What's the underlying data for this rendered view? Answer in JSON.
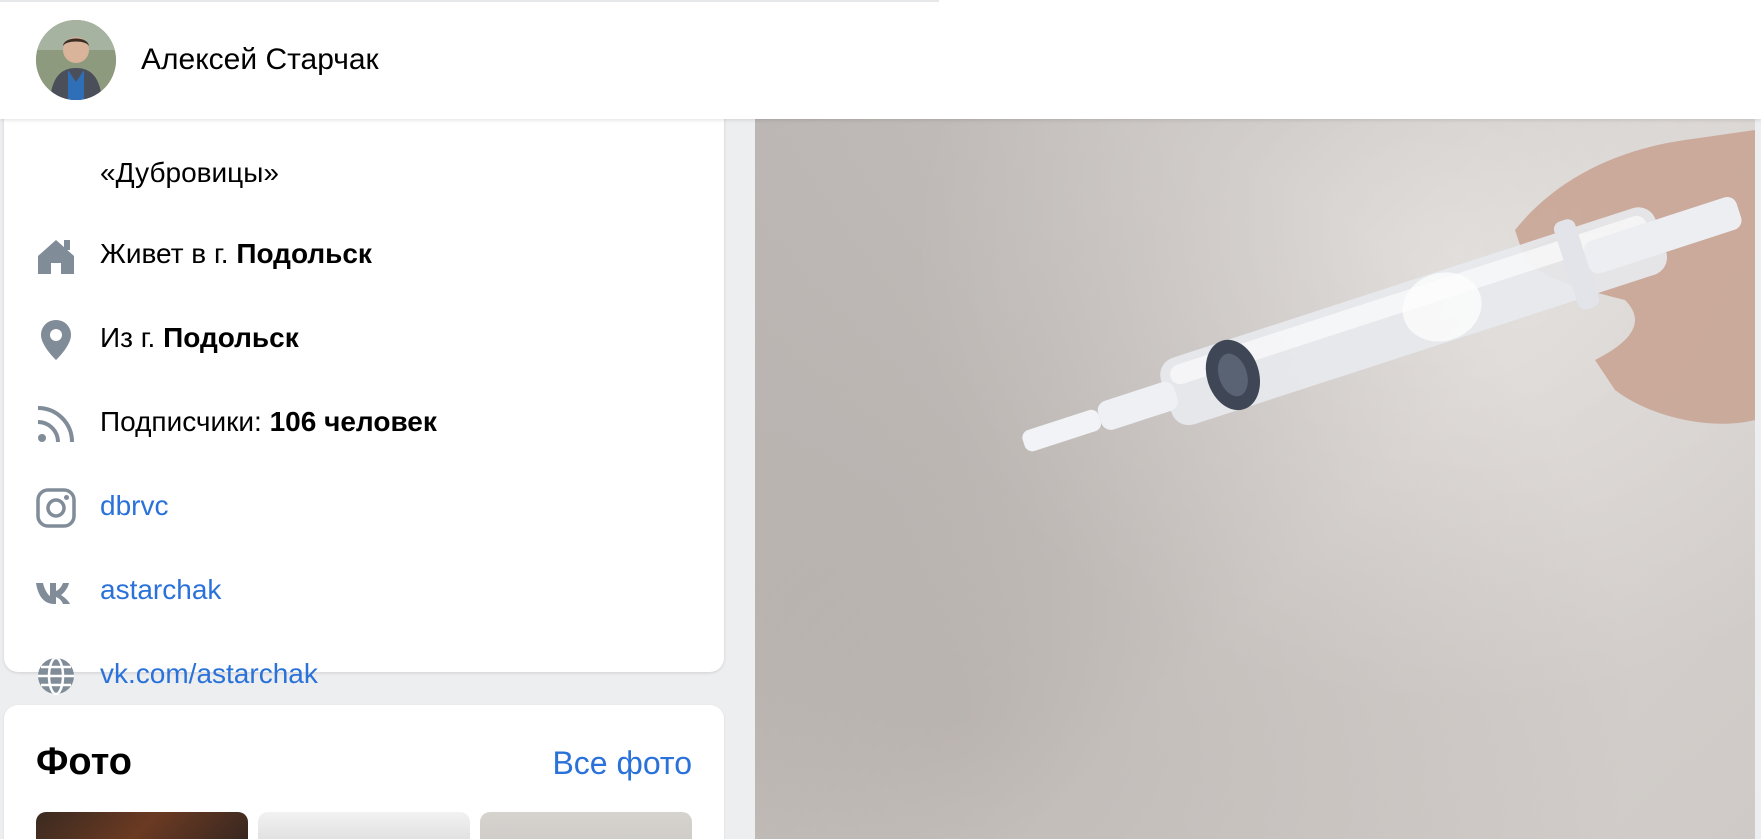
{
  "header": {
    "name": "Алексей Старчак"
  },
  "info": {
    "clipped_text": "«Дубровицы»",
    "rows": [
      {
        "icon": "home-icon",
        "prefix": "Живет в г. ",
        "value": "Подольск"
      },
      {
        "icon": "location-pin-icon",
        "prefix": "Из г. ",
        "value": "Подольск"
      },
      {
        "icon": "rss-icon",
        "prefix": "Подписчики: ",
        "value": "106 человек"
      }
    ],
    "links": [
      {
        "icon": "instagram-icon",
        "label": "dbrvc"
      },
      {
        "icon": "vk-icon",
        "label": "astarchak"
      },
      {
        "icon": "globe-icon",
        "label": "vk.com/astarchak"
      }
    ]
  },
  "photos": {
    "title": "Фото",
    "all_link": "Все фото"
  },
  "colors": {
    "link": "#2a72d9",
    "icon": "#818c99",
    "background": "#edeef0"
  }
}
